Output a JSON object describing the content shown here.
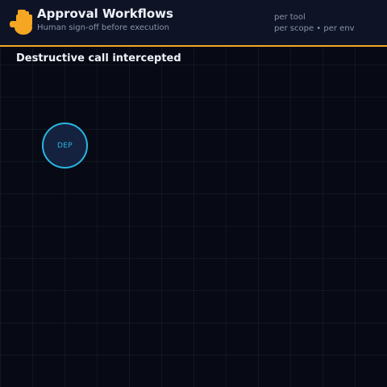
{
  "header": {
    "logo_icon": "hand-stop-icon",
    "title": "Approval Workflows",
    "subtitle": "Human sign-off before execution",
    "meta_lines": [
      "per tool",
      "per scope • per env"
    ]
  },
  "canvas": {
    "section_title": "Destructive call intercepted",
    "nodes": [
      {
        "label": "DEP",
        "state": "active"
      }
    ]
  },
  "colors": {
    "background": "#070a14",
    "header_background": "#0e1426",
    "accent": "#f5a623",
    "node_stroke": "#29b6e0",
    "node_fill": "#15223f",
    "title_text": "#eef1f8",
    "muted_text": "#8a93ab"
  }
}
